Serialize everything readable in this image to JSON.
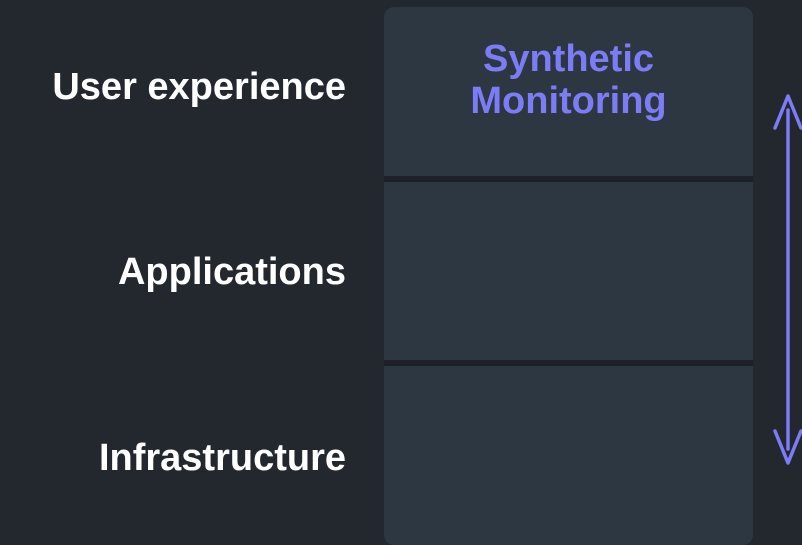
{
  "layers": {
    "user_experience": "User experience",
    "applications": "Applications",
    "infrastructure": "Infrastructure"
  },
  "stack": {
    "title_line1": "Synthetic",
    "title_line2": "Monitoring"
  },
  "colors": {
    "background": "#23272e",
    "cell": "#2d3742",
    "accent": "#7d7cf7",
    "label": "#ffffff"
  },
  "icons": {
    "arrow": "double-headed-vertical-arrow"
  }
}
